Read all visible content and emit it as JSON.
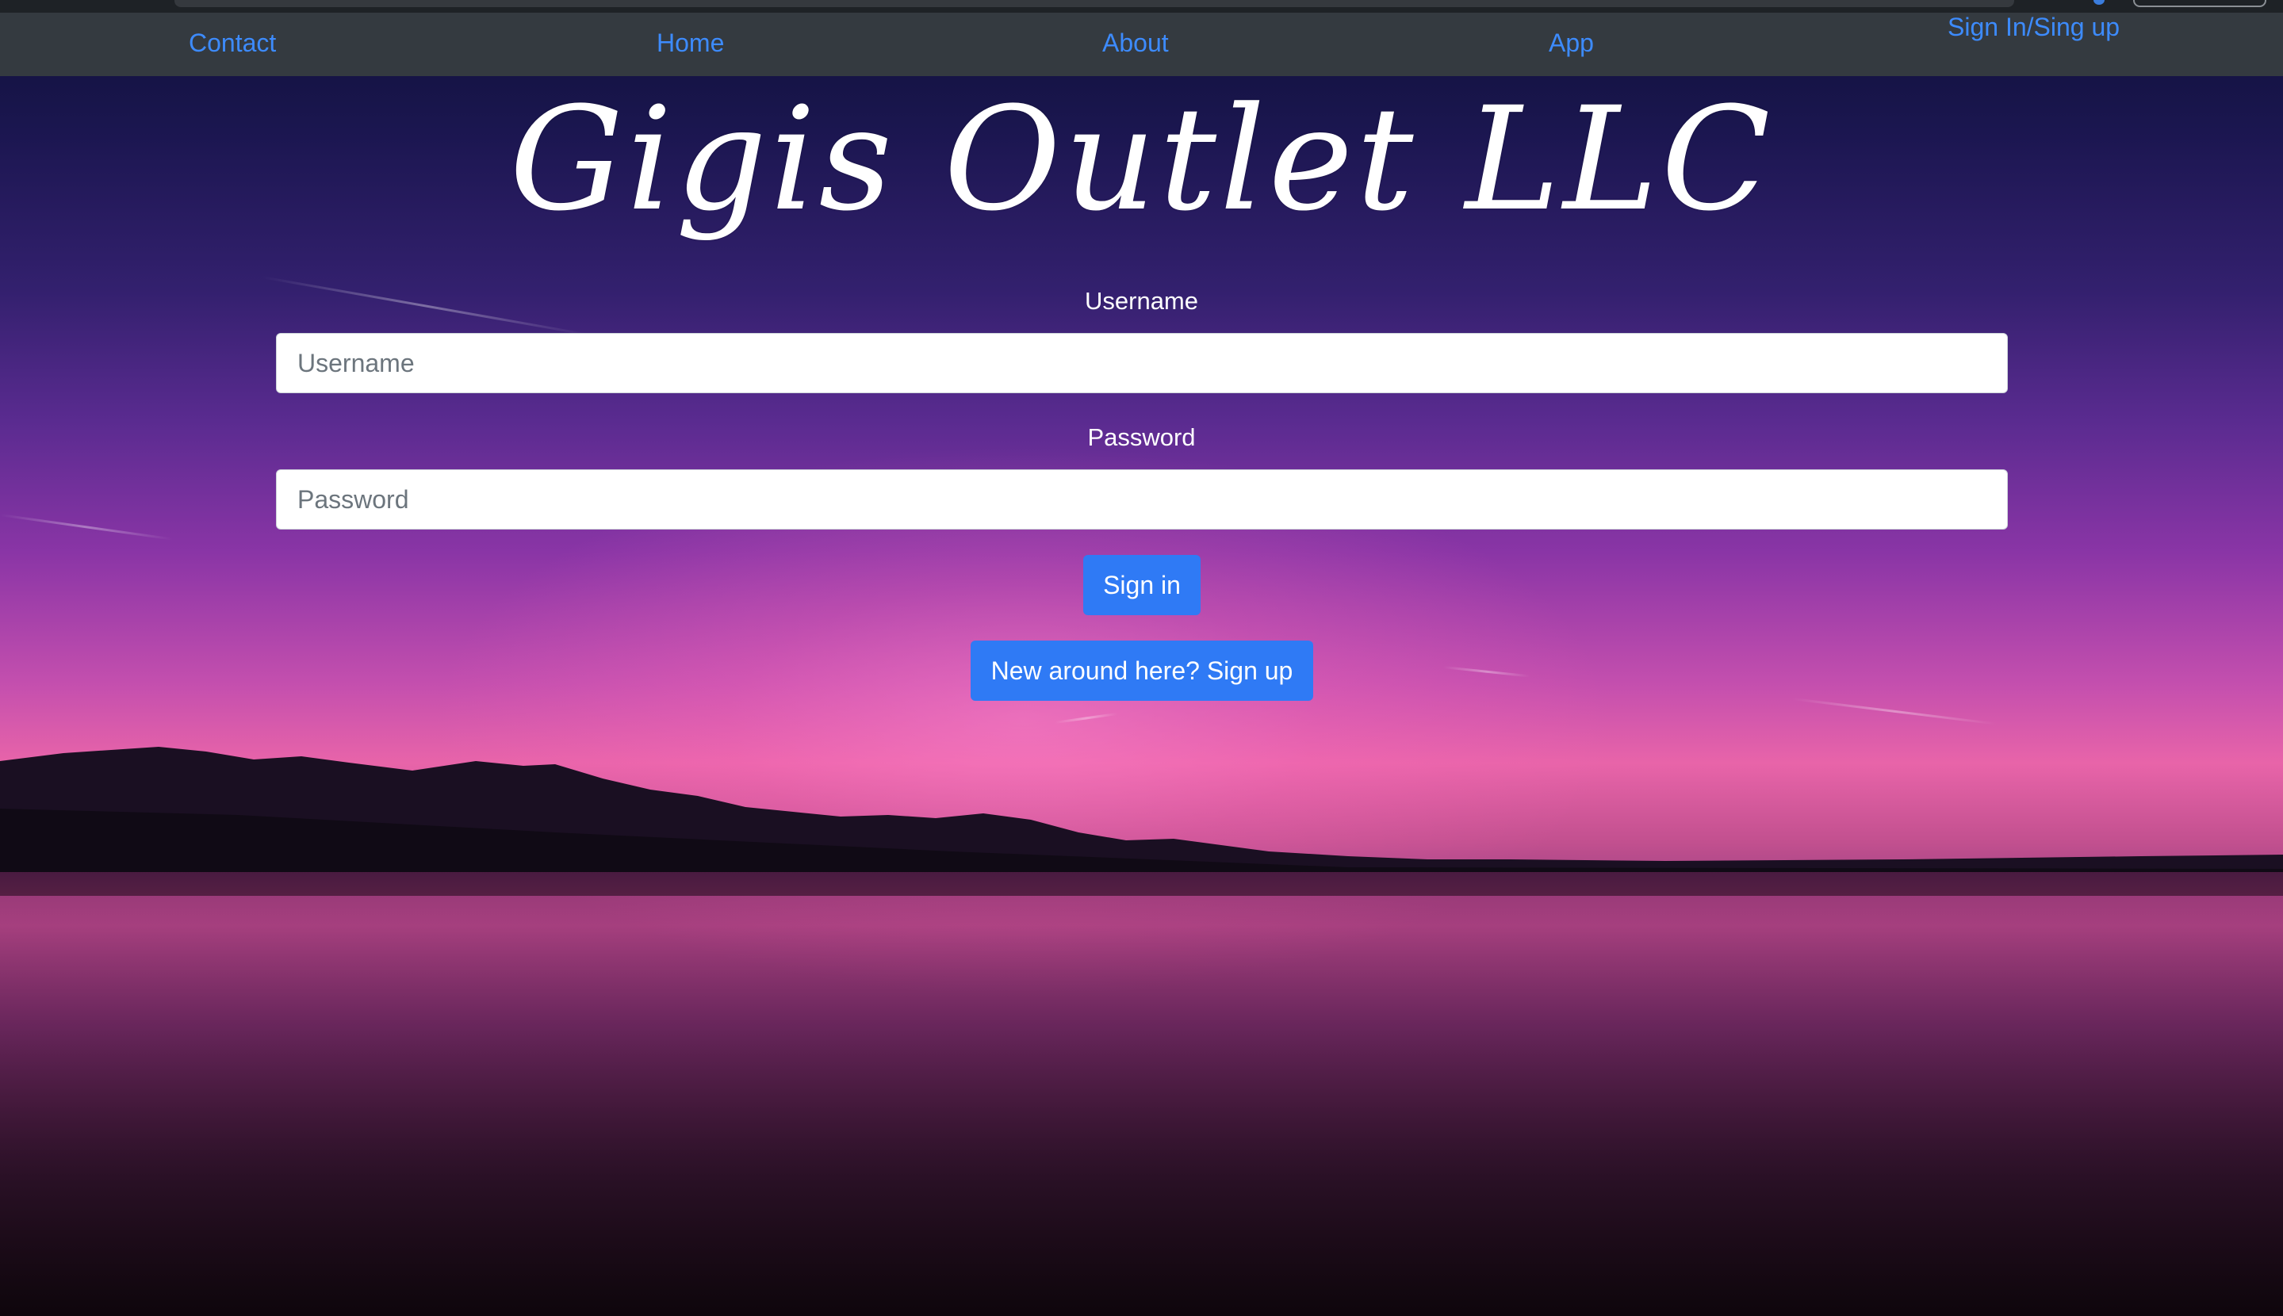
{
  "navbar": {
    "links": [
      {
        "label": "Contact"
      },
      {
        "label": "Home"
      },
      {
        "label": "About"
      },
      {
        "label": "App"
      },
      {
        "label": "Sign In/Sing up"
      }
    ]
  },
  "brand": {
    "title": "Gigis Outlet LLC"
  },
  "form": {
    "username_label": "Username",
    "username_placeholder": "Username",
    "username_value": "",
    "password_label": "Password",
    "password_placeholder": "Password",
    "password_value": "",
    "signin_label": "Sign in",
    "signup_label": "New around here? Sign up"
  },
  "colors": {
    "navbar_bg": "#343a40",
    "link": "#3d8bfd",
    "button_primary": "#2f7af5",
    "text_light": "#ffffff"
  }
}
